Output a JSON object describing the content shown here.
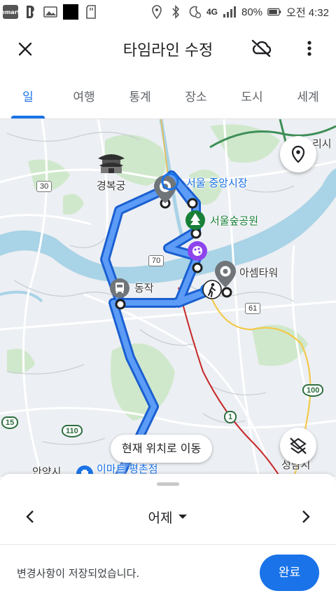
{
  "status_bar": {
    "left_icons": [
      "emart-icon",
      "b-app-icon",
      "gallery-icon",
      "black-square-icon",
      "sd-card-icon"
    ],
    "emart_text": "emart",
    "right_icons": [
      "location-icon",
      "bluetooth-icon",
      "alarm-icon",
      "4g-icon",
      "signal-icon"
    ],
    "network": "4G",
    "battery": "80%",
    "time": "오전 4:32"
  },
  "app_bar": {
    "title": "타임라인 수정",
    "close_icon": "close-icon",
    "sync_icon": "cloud-off-icon",
    "more_icon": "more-vert-icon"
  },
  "tabs": [
    {
      "label": "일",
      "active": true
    },
    {
      "label": "여행",
      "active": false
    },
    {
      "label": "통계",
      "active": false
    },
    {
      "label": "장소",
      "active": false
    },
    {
      "label": "도시",
      "active": false
    },
    {
      "label": "세계",
      "active": false
    }
  ],
  "map": {
    "places": {
      "gyeongbokgung": "경복궁",
      "market": "서울 중앙시장",
      "forest": "서울숲공원",
      "asem": "아셈타워",
      "dongjak": "동작",
      "anyang": "안양시",
      "emart": "이마트 평촌점",
      "seongnam": "성남시",
      "top_right": "리시"
    },
    "road_numbers": {
      "r30": "30",
      "r70": "70",
      "r61": "61",
      "r100": "100",
      "r15": "15",
      "r110": "110",
      "r1": "1"
    },
    "move_button": "현재 위치로 이동",
    "colors": {
      "route": "#4f8ef5",
      "route_outline": "#1a5fd1",
      "water": "#a9d3e6",
      "park": "#c9e9c8",
      "primary": "#1a73e8"
    }
  },
  "sheet": {
    "date_label": "어제"
  },
  "snackbar": {
    "message": "변경사항이 저장되었습니다.",
    "button": "완료"
  }
}
